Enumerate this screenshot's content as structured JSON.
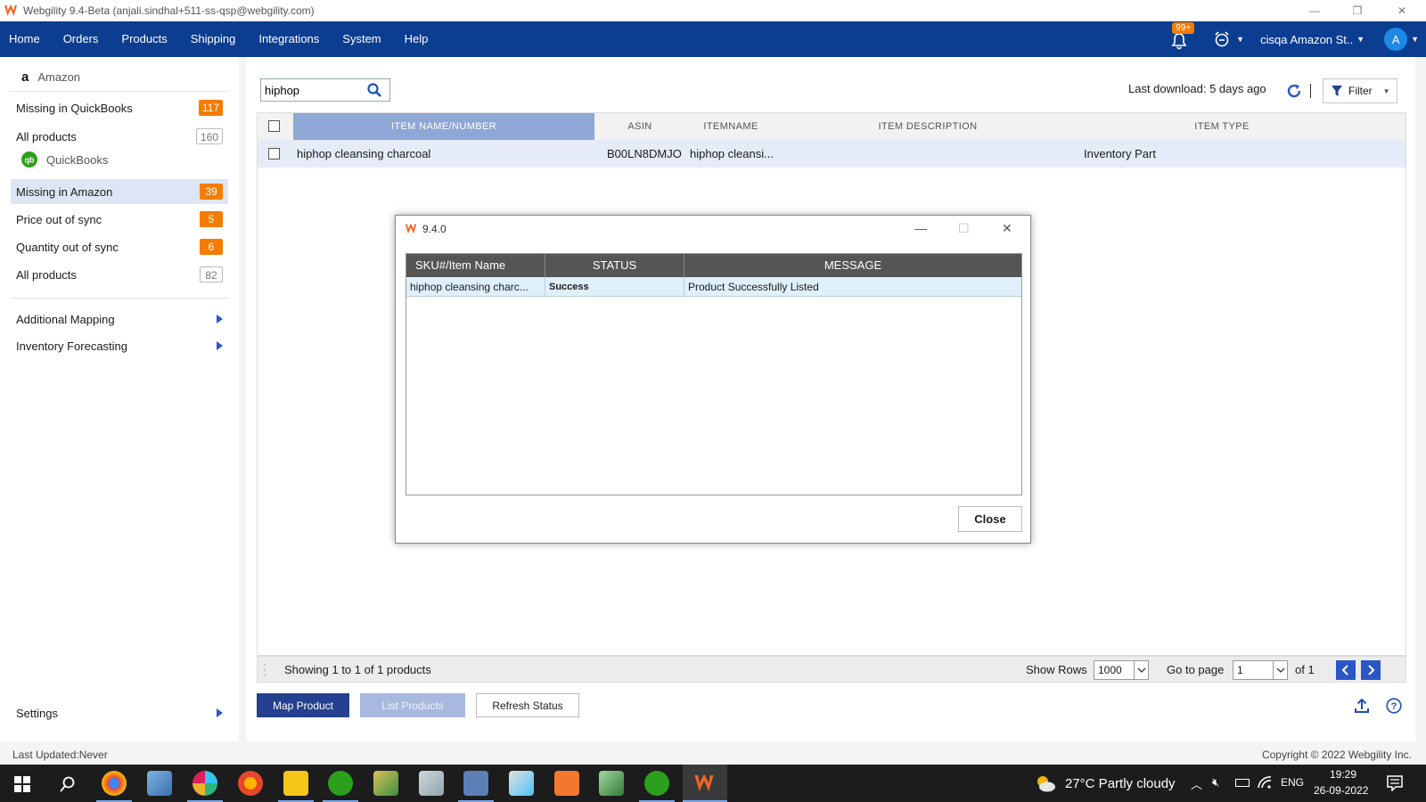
{
  "window": {
    "title": "Webgility 9.4-Beta (anjali.sindhal+511-ss-qsp@webgility.com)"
  },
  "menu": {
    "items": [
      "Home",
      "Orders",
      "Products",
      "Shipping",
      "Integrations",
      "System",
      "Help"
    ],
    "notifications_badge": "99+",
    "store": "cisqa Amazon St..",
    "avatar_letter": "A"
  },
  "sidebar": {
    "amazon_label": "Amazon",
    "quickbooks_label": "QuickBooks",
    "amazon_items": [
      {
        "label": "Missing in QuickBooks",
        "count": "117"
      },
      {
        "label": "All products",
        "count": "160"
      }
    ],
    "qb_items": [
      {
        "label": "Missing in Amazon",
        "count": "39"
      },
      {
        "label": "Price out of sync",
        "count": "5"
      },
      {
        "label": "Quantity out of sync",
        "count": "6"
      },
      {
        "label": "All products",
        "count": "82"
      }
    ],
    "additional_mapping": "Additional Mapping",
    "inventory_forecasting": "Inventory Forecasting",
    "settings": "Settings"
  },
  "toolbar": {
    "search_value": "hiphop",
    "last_download": "Last download: 5 days ago",
    "filter_label": "Filter"
  },
  "grid": {
    "columns": [
      "ITEM NAME/NUMBER",
      "ASIN",
      "ITEMNAME",
      "ITEM DESCRIPTION",
      "ITEM TYPE"
    ],
    "rows": [
      {
        "item_name": "hiphop cleansing charcoal",
        "asin": "B00LN8DMJO",
        "itemname": "hiphop cleansi...",
        "description": "",
        "type": "Inventory Part"
      }
    ]
  },
  "footer": {
    "showing": "Showing 1 to 1 of 1 products",
    "show_rows_label": "Show Rows",
    "rows_value": "1000",
    "goto_label": "Go to page",
    "page_value": "1",
    "of_label": "of 1"
  },
  "buttons": {
    "map_product": "Map Product",
    "list_products": "List Products",
    "refresh_status": "Refresh Status"
  },
  "statusbar": {
    "last_updated": "Last Updated:Never",
    "copyright": "Copyright © 2022 Webgility Inc."
  },
  "dialog": {
    "title": "9.4.0",
    "columns": [
      "SKU#/Item Name",
      "STATUS",
      "MESSAGE"
    ],
    "rows": [
      {
        "sku": "hiphop cleansing charc...",
        "status": "Success",
        "message": "Product Successfully Listed"
      }
    ],
    "close_label": "Close"
  },
  "taskbar": {
    "weather": "27°C  Partly cloudy",
    "lang": "ENG",
    "time": "19:29",
    "date": "26-09-2022"
  },
  "colors": {
    "menubar": "#0b3d91",
    "badge": "#f57c00",
    "accent": "#2b57c6"
  }
}
